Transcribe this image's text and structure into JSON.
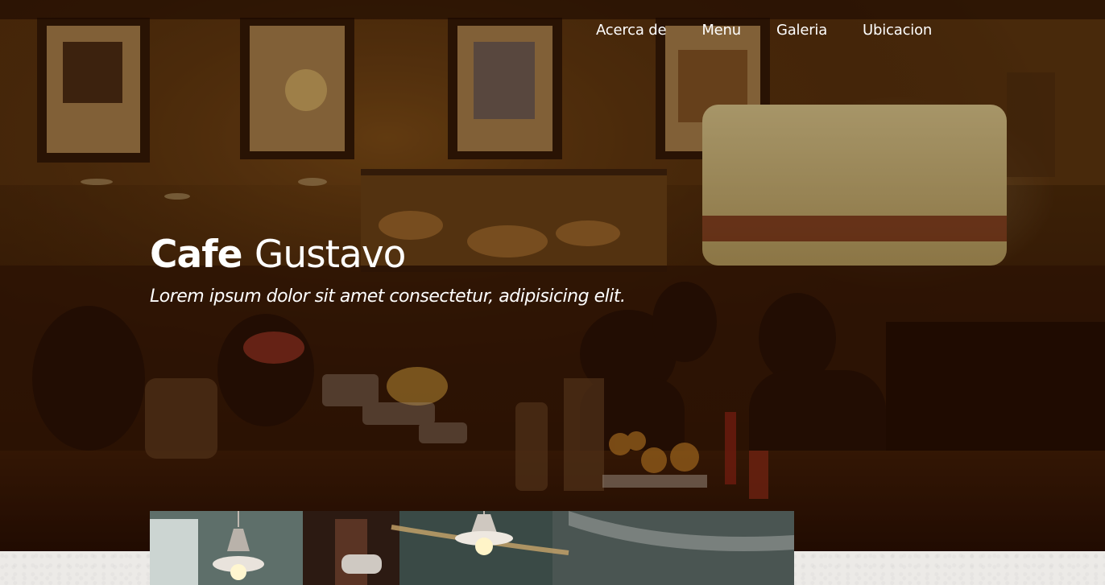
{
  "nav": {
    "items": [
      {
        "label": "Acerca de"
      },
      {
        "label": "Menu"
      },
      {
        "label": "Galeria"
      },
      {
        "label": "Ubicacion"
      }
    ]
  },
  "hero": {
    "title_strong": "Cafe",
    "title_light": "Gustavo",
    "tagline": "Lorem ipsum dolor sit amet consectetur, adipisicing elit.",
    "background_image": "cafe-interior-photo"
  },
  "feature": {
    "image": "cafe-pendant-lamps-photo"
  },
  "colors": {
    "overlay": "#2a0c00",
    "text": "#ffffff",
    "page_background": "#ebeae8"
  }
}
